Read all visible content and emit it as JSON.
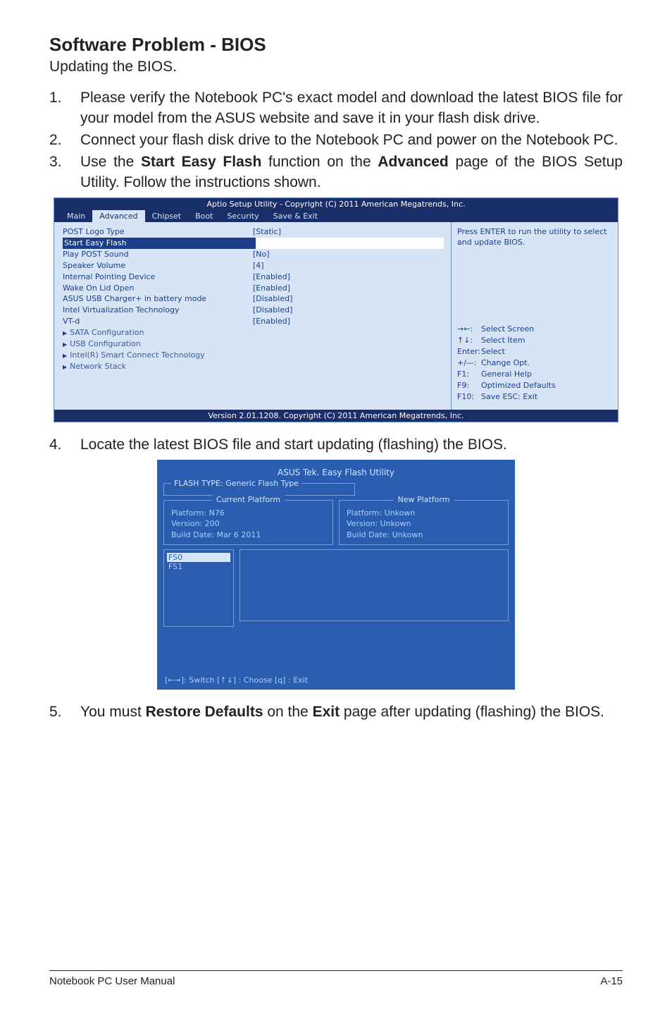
{
  "heading": "Software Problem - BIOS",
  "subtitle": "Updating the BIOS.",
  "steps": {
    "1": "Please verify the Notebook PC's exact model and download the latest BIOS file for your model from the ASUS website and save it in your flash disk drive.",
    "2": "Connect your flash disk drive to the Notebook PC and power on the Notebook PC.",
    "3_pre": "Use the ",
    "3_b1": "Start Easy Flash",
    "3_mid": " function on the ",
    "3_b2": "Advanced",
    "3_post": " page of the BIOS Setup Utility. Follow the instructions shown.",
    "4": "Locate the latest BIOS file and start updating (flashing) the BIOS.",
    "5_pre": "You must ",
    "5_b1": "Restore Defaults",
    "5_mid": " on the ",
    "5_b2": "Exit",
    "5_post": " page after updating (flashing) the BIOS."
  },
  "bios1": {
    "title": "Aptio Setup Utility - Copyright (C) 2011 American Megatrends, Inc.",
    "tabs": [
      "Main",
      "Advanced",
      "Chipset",
      "Boot",
      "Security",
      "Save & Exit"
    ],
    "rows": [
      {
        "label": "POST Logo Type",
        "value": "[Static]"
      },
      {
        "label": "Start Easy Flash",
        "value": ""
      },
      {
        "label": "Play POST Sound",
        "value": "[No]"
      },
      {
        "label": "Speaker Volume",
        "value": "[4]"
      },
      {
        "label": "Internal Pointing Device",
        "value": "[Enabled]"
      },
      {
        "label": "Wake On Lid Open",
        "value": "[Enabled]"
      },
      {
        "label": "ASUS USB Charger+ in battery mode",
        "value": "[Disabled]"
      },
      {
        "label": "",
        "value": ""
      },
      {
        "label": "Intel Virtualization Technology",
        "value": "[Disabled]"
      },
      {
        "label": "  VT-d",
        "value": "[Enabled]"
      }
    ],
    "subs": [
      "SATA Configuration",
      "USB Configuration",
      "Intel(R) Smart Connect Technology",
      "Network Stack"
    ],
    "help1": "Press ENTER to run the utility to select and update BIOS.",
    "help2": [
      {
        "k": "→←:",
        "v": "Select Screen"
      },
      {
        "k": "↑↓:",
        "v": "Select Item"
      },
      {
        "k": "Enter:",
        "v": "Select"
      },
      {
        "k": "+/—:",
        "v": "Change Opt."
      },
      {
        "k": "F1:",
        "v": "General Help"
      },
      {
        "k": "F9:",
        "v": "Optimized Defaults"
      },
      {
        "k": "F10:",
        "v": "Save   ESC: Exit"
      }
    ],
    "footer": "Version 2.01.1208. Copyright (C) 2011 American Megatrends, Inc."
  },
  "bios2": {
    "title": "ASUS Tek. Easy Flash Utility",
    "flashtype": "FLASH TYPE: Generic Flash Type",
    "current_head": "Current Platform",
    "current": [
      "Platform:  N76",
      "Version:     200",
      "Build Date: Mar 6 2011"
    ],
    "new_head": "New Platform",
    "new": [
      "Platform:  Unkown",
      "Version:    Unkown",
      "Build Date: Unkown"
    ],
    "drives": [
      "FS0",
      "FS1"
    ],
    "hint": "[←→]: Switch   [↑↓] : Choose   [q] : Exit"
  },
  "footer": {
    "left": "Notebook PC User Manual",
    "right": "A-15"
  }
}
